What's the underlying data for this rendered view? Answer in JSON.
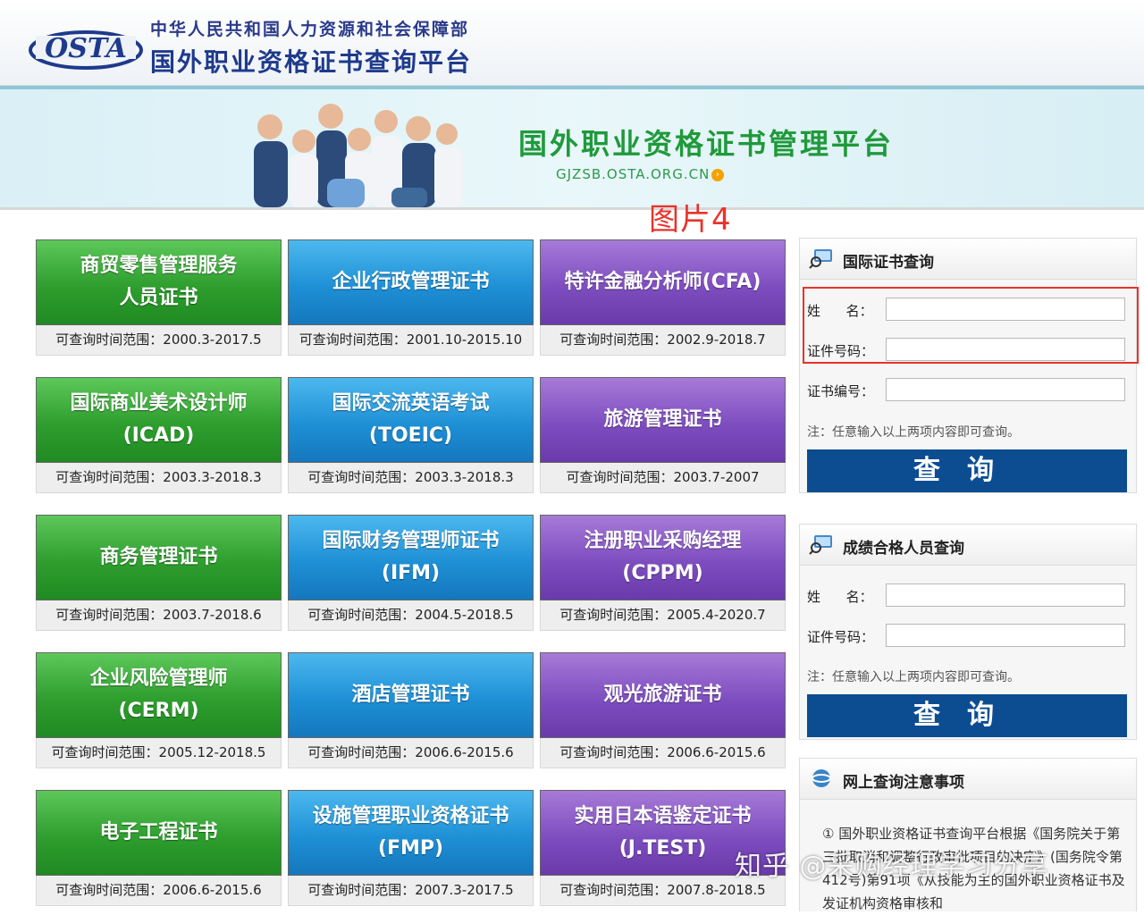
{
  "header": {
    "logo_text": "OSTA",
    "ministry": "中华人民共和国人力资源和社会保障部",
    "title": "国外职业资格证书查询平台"
  },
  "banner": {
    "title": "国外职业资格证书管理平台",
    "url": "GJZSB.OSTA.ORG.CN",
    "url_icon": "arrow-right-circle-icon"
  },
  "caption": "图片4",
  "tiles": [
    {
      "lines": [
        "商贸零售管理服务",
        "人员证书"
      ],
      "range": "可查询时间范围：2000.3-2017.5",
      "color": "green"
    },
    {
      "lines": [
        "企业行政管理证书"
      ],
      "range": "可查询时间范围：2001.10-2015.10",
      "color": "blue"
    },
    {
      "lines": [
        "特许金融分析师(CFA)"
      ],
      "range": "可查询时间范围：2002.9-2018.7",
      "color": "purple"
    },
    {
      "lines": [
        "国际商业美术设计师",
        "(ICAD)"
      ],
      "range": "可查询时间范围：2003.3-2018.3",
      "color": "green"
    },
    {
      "lines": [
        "国际交流英语考试",
        "(TOEIC)"
      ],
      "range": "可查询时间范围：2003.3-2018.3",
      "color": "blue"
    },
    {
      "lines": [
        "旅游管理证书"
      ],
      "range": "可查询时间范围：2003.7-2007",
      "color": "purple"
    },
    {
      "lines": [
        "商务管理证书"
      ],
      "range": "可查询时间范围：2003.7-2018.6",
      "color": "green"
    },
    {
      "lines": [
        "国际财务管理师证书",
        "(IFM)"
      ],
      "range": "可查询时间范围：2004.5-2018.5",
      "color": "blue"
    },
    {
      "lines": [
        "注册职业采购经理",
        "(CPPM)"
      ],
      "range": "可查询时间范围：2005.4-2020.7",
      "color": "purple"
    },
    {
      "lines": [
        "企业风险管理师",
        "(CERM)"
      ],
      "range": "可查询时间范围：2005.12-2018.5",
      "color": "green"
    },
    {
      "lines": [
        "酒店管理证书"
      ],
      "range": "可查询时间范围：2006.6-2015.6",
      "color": "blue"
    },
    {
      "lines": [
        "观光旅游证书"
      ],
      "range": "可查询时间范围：2006.6-2015.6",
      "color": "purple"
    },
    {
      "lines": [
        "电子工程证书"
      ],
      "range": "可查询时间范围：2006.6-2015.6",
      "color": "green"
    },
    {
      "lines": [
        "设施管理职业资格证书",
        "(FMP)"
      ],
      "range": "可查询时间范围：2007.3-2017.5",
      "color": "blue"
    },
    {
      "lines": [
        "实用日本语鉴定证书",
        "(J.TEST)"
      ],
      "range": "可查询时间范围：2007.8-2018.5",
      "color": "purple"
    }
  ],
  "cert_query": {
    "title": "国际证书查询",
    "name_label": "姓      名：",
    "id_label": "证件号码：",
    "cert_no_label": "证书编号：",
    "note": "注：任意输入以上两项内容即可查询。",
    "button": "查询"
  },
  "score_query": {
    "title": "成绩合格人员查询",
    "name_label": "姓      名：",
    "id_label": "证件号码：",
    "note": "注：任意输入以上两项内容即可查询。",
    "button": "查询"
  },
  "notice": {
    "title": "网上查询注意事项",
    "body": "① 国外职业资格证书查询平台根据《国务院关于第三批取消和调整行政审批项目的决定》(国务院令第412号)第91项《从技能为主的国外职业资格证书及发证机构资格审核和"
  },
  "watermark": "知乎 @采购经理学习分享"
}
